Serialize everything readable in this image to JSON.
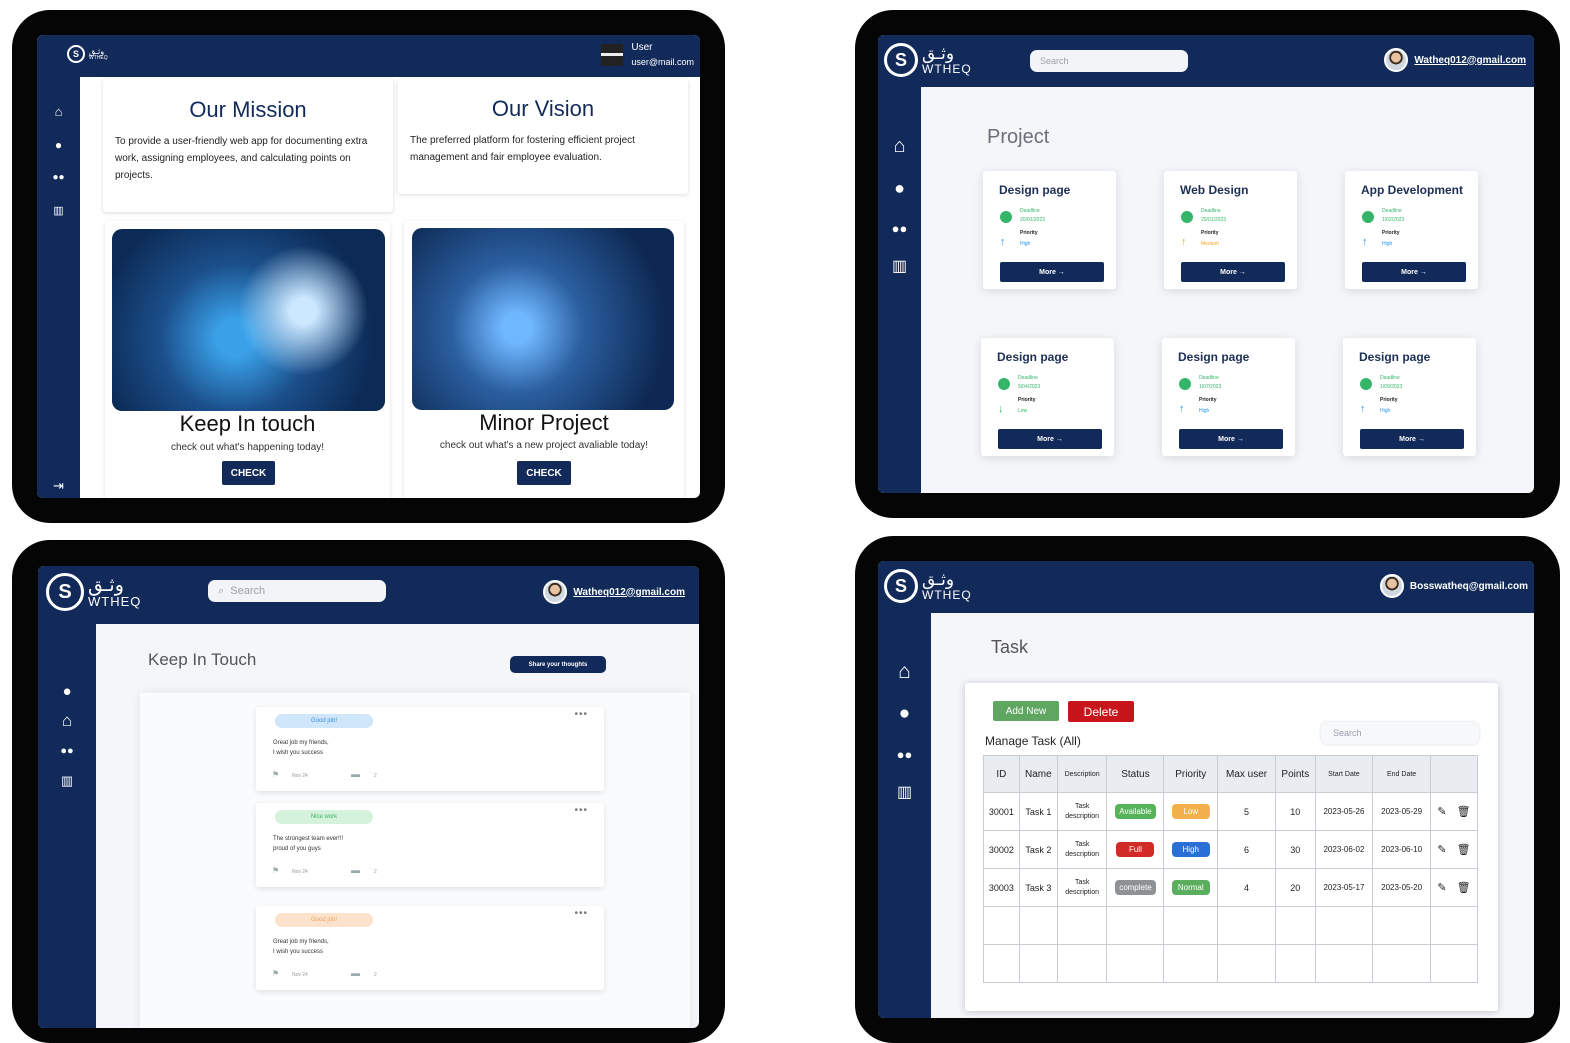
{
  "home": {
    "user_name": "User",
    "user_email": "user@mail.com",
    "mission_title": "Our Mission",
    "mission_text": "To provide a user-friendly web app for documenting extra work, assigning employees, and calculating points on projects.",
    "vision_title": "Our Vision",
    "vision_text": "The preferred platform for fostering efficient project management and fair employee evaluation.",
    "touch_title": "Keep In touch",
    "touch_text": "check out what's happening today!",
    "touch_button": "CHECK",
    "minor_title": "Minor Project",
    "minor_text": "check out what's a new project avaliable today!",
    "minor_button": "CHECK"
  },
  "logo": {
    "arabic": "وثـق",
    "latin": "WTHEQ"
  },
  "projects": {
    "search_placeholder": "Search",
    "user_email": "Watheq012@gmail.com",
    "page_title": "Project",
    "deadline_label": "Deadline",
    "priority_label": "Priority",
    "more_label": "More →",
    "cards": [
      {
        "title": "Design page",
        "deadline": "20/01/2023",
        "priority": "High",
        "priority_color": "#2196f3"
      },
      {
        "title": "Web Design",
        "deadline": "20/01/2023",
        "priority": "Medium",
        "priority_color": "#f5a623"
      },
      {
        "title": "App Development",
        "deadline": "1/02/2023",
        "priority": "High",
        "priority_color": "#2196f3"
      },
      {
        "title": "Design page",
        "deadline": "5/04/2023",
        "priority": "Low",
        "priority_color": "#2bbd5a"
      },
      {
        "title": "Design page",
        "deadline": "1/07/2023",
        "priority": "High",
        "priority_color": "#2196f3"
      },
      {
        "title": "Design page",
        "deadline": "1/09/2023",
        "priority": "High",
        "priority_color": "#2196f3"
      }
    ]
  },
  "touch": {
    "search_placeholder": "Search",
    "user_email": "Watheq012@gmail.com",
    "page_title": "Keep In Touch",
    "share_button": "Share your thoughts",
    "posts": [
      {
        "tag": "Good job!",
        "tag_color": "#cfe6fb",
        "tag_text_color": "#3a8fd8",
        "text1": "Great job my friends,",
        "text2": "I wish you success",
        "date": "Nov 24",
        "comments": "2"
      },
      {
        "tag": "Nice work",
        "tag_color": "#d5f2dd",
        "tag_text_color": "#3bb469",
        "text1": "The strongest team ever!!!",
        "text2": "proud of you guys",
        "date": "Nov 24",
        "comments": "2"
      },
      {
        "tag": "Good job!",
        "tag_color": "#fde3cc",
        "tag_text_color": "#e9a466",
        "text1": "Great job my friends,",
        "text2": "I wish you success",
        "date": "Nov 24",
        "comments": "2"
      }
    ]
  },
  "tasks": {
    "user_email": "Bosswatheq@gmail.com",
    "page_title": "Task",
    "add_button": "Add New",
    "delete_button": "Delete",
    "search_placeholder": "Search",
    "manage_label": "Manage Task (All)",
    "columns": [
      "ID",
      "Name",
      "Description",
      "Status",
      "Priority",
      "Max user",
      "Points",
      "Start Date",
      "End Date",
      ""
    ],
    "rows": [
      {
        "id": "30001",
        "name": "Task 1",
        "desc1": "Task",
        "desc2": "description",
        "status": "Available",
        "status_color": "#56b35a",
        "priority": "Low",
        "priority_color": "#f4b04a",
        "max_user": "5",
        "points": "10",
        "start": "2023-05-26",
        "end": "2023-05-29"
      },
      {
        "id": "30002",
        "name": "Task 2",
        "desc1": "Task",
        "desc2": "description",
        "status": "Full",
        "status_color": "#d02c27",
        "priority": "High",
        "priority_color": "#2a6fd6",
        "max_user": "6",
        "points": "30",
        "start": "2023-06-02",
        "end": "2023-06-10"
      },
      {
        "id": "30003",
        "name": "Task 3",
        "desc1": "Task",
        "desc2": "description",
        "status": "complete",
        "status_color": "#8f9294",
        "priority": "Normal",
        "priority_color": "#5cae5f",
        "max_user": "4",
        "points": "20",
        "start": "2023-05-17",
        "end": "2023-05-20"
      }
    ]
  }
}
